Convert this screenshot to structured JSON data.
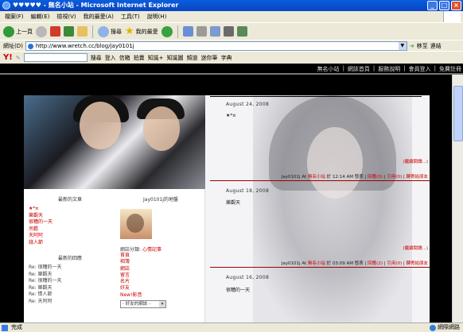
{
  "window": {
    "title": "♥♥♥♥♥ - 無名小站 - Microsoft Internet Explorer"
  },
  "menu": [
    "檔案(F)",
    "編輯(E)",
    "檢視(V)",
    "我的最愛(A)",
    "工具(T)",
    "說明(H)"
  ],
  "toolbar": {
    "back": "上一頁",
    "search": "搜尋",
    "favorites": "我的最愛"
  },
  "address": {
    "label": "網址(D)",
    "url": "http://www.wretch.cc/blog/jay0101j",
    "go": "移至",
    "links": "連結"
  },
  "yahoo": {
    "logo": "Y!",
    "search": "搜尋",
    "login": "登入",
    "items": [
      "信箱",
      "拍賣",
      "知識+",
      "知識圖",
      "頻道",
      "迷你筆",
      "字典"
    ]
  },
  "topnav": [
    "無名小站",
    "網誌首頁",
    "服務說明",
    "會員登入",
    "免費註冊"
  ],
  "sidebar": {
    "recent_title": "最新的文章",
    "recent": [
      "★*¤",
      "樂觀天",
      "很糟的一天",
      "吊膽",
      "天阿阿",
      "錢人節"
    ],
    "comments_title": "最新的回應",
    "comments": [
      "Re: 很糟的一天",
      "Re: 樂觀天",
      "Re: 很糟的一天",
      "Re: 樂觀天",
      "Re: 情人節",
      "Re: 天阿阿"
    ]
  },
  "profile": {
    "name": "Jay0101j的地盤",
    "category_label": "網誌分類:",
    "category": "心情記事",
    "links": [
      "首頁",
      "相簿",
      "網誌",
      "留言",
      "名片",
      "好友",
      "New!影音"
    ],
    "friend_select": "- 好友的網誌 -"
  },
  "posts": [
    {
      "date": "August 24, 2008",
      "text": "★*¤",
      "more": "(繼續閱讀...)",
      "author": "Jay0101j",
      "site": "無名小站",
      "time": "12:14 AM",
      "comments": "回應(0)",
      "trackback": "引用(0)",
      "recommend": "轉寄給朋友"
    },
    {
      "date": "August 18, 2008",
      "text": "樂觀天",
      "more": "(繼續閱讀...)",
      "author": "Jay0101j",
      "site": "無名小站",
      "time": "03:09 AM",
      "comments": "回應(2)",
      "trackback": "引用(0)",
      "recommend": "轉寄給朋友"
    },
    {
      "date": "August 16, 2008",
      "text": "很糟的一天"
    }
  ],
  "meta": {
    "at": "At",
    "on": "於",
    "posted": "發表"
  },
  "status": {
    "text": "完成",
    "zone": "網際網路"
  }
}
